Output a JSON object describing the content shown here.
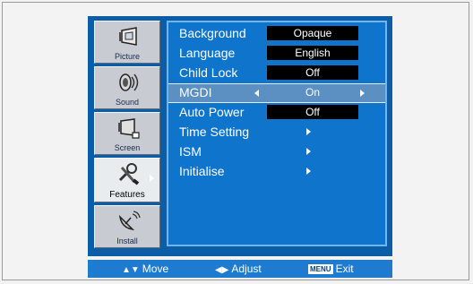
{
  "sidebar": {
    "items": [
      {
        "label": "Picture",
        "icon": "picture-icon",
        "active": false
      },
      {
        "label": "Sound",
        "icon": "speaker-icon",
        "active": false
      },
      {
        "label": "Screen",
        "icon": "screen-icon",
        "active": false
      },
      {
        "label": "Features",
        "icon": "tools-icon",
        "active": true
      },
      {
        "label": "Install",
        "icon": "satellite-dish-icon",
        "active": false
      }
    ]
  },
  "menu": {
    "rows": [
      {
        "label": "Background",
        "value": "Opaque"
      },
      {
        "label": "Language",
        "value": "English"
      },
      {
        "label": "Child Lock",
        "value": "Off"
      },
      {
        "label": "MGDI",
        "value": "On",
        "selected": true
      },
      {
        "label": "Auto Power",
        "value": "Off"
      },
      {
        "label": "Time Setting",
        "submenu": true
      },
      {
        "label": "ISM",
        "submenu": true
      },
      {
        "label": "Initialise",
        "submenu": true
      }
    ]
  },
  "footer": {
    "move_label": "Move",
    "adjust_label": "Adjust",
    "menu_key": "MENU",
    "exit_label": "Exit"
  },
  "colors": {
    "osd_background": "#0a5da6",
    "panel": "#0f74cc",
    "highlight": "#5c8fc2"
  }
}
